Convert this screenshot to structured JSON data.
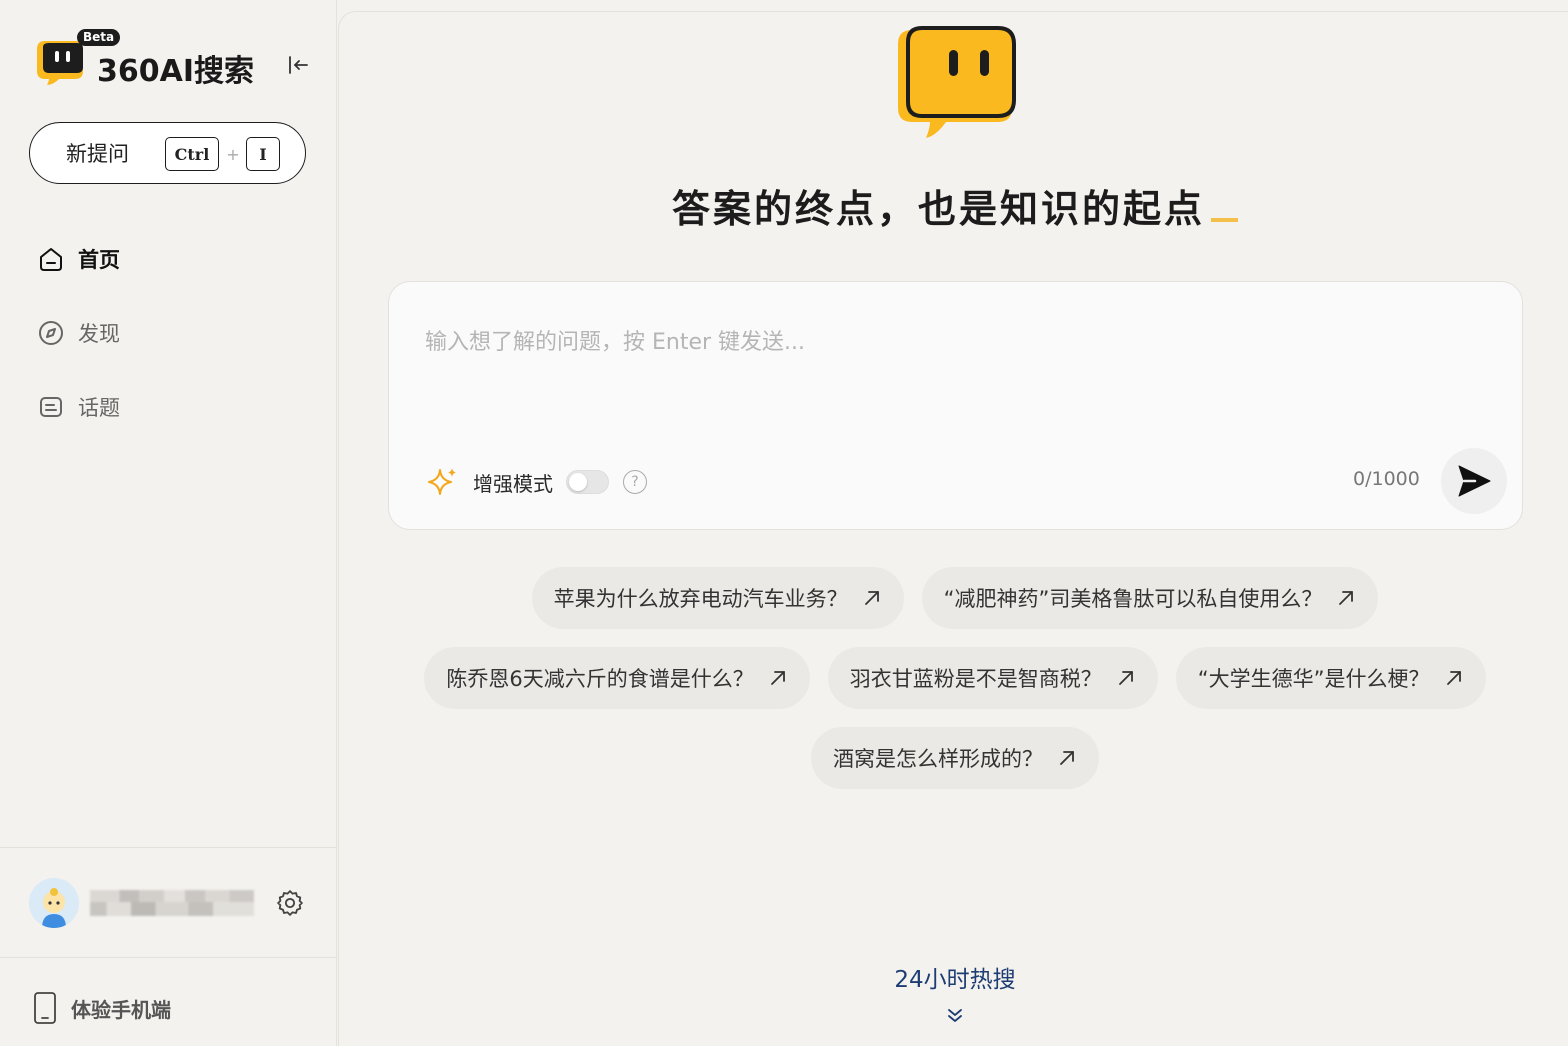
{
  "sidebar": {
    "logo_text": "360AI搜索",
    "beta": "Beta",
    "new_question": {
      "label": "新提问",
      "shortcut_ctrl": "Ctrl",
      "shortcut_plus": "+",
      "shortcut_key": "I"
    },
    "nav": [
      {
        "label": "首页",
        "icon": "home-icon",
        "active": true
      },
      {
        "label": "发现",
        "icon": "compass-icon",
        "active": false
      },
      {
        "label": "话题",
        "icon": "topic-icon",
        "active": false
      }
    ],
    "mobile_label": "体验手机端"
  },
  "main": {
    "headline": "答案的终点，也是知识的起点",
    "search": {
      "placeholder": "输入想了解的问题，按 Enter 键发送...",
      "value": "",
      "enhance_label": "增强模式",
      "enhance_on": false,
      "char_count": "0/1000"
    },
    "suggestions": [
      "苹果为什么放弃电动汽车业务？",
      "“减肥神药”司美格鲁肽可以私自使用么？",
      "陈乔恩6天减六斤的食谱是什么？",
      "羽衣甘蓝粉是不是智商税？",
      "“大学生德华”是什么梗？",
      "酒窝是怎么样形成的？"
    ],
    "hot_search": "24小时热搜"
  },
  "colors": {
    "brand_yellow": "#f9b91f",
    "accent_cursor": "#f5c04a",
    "hot_link": "#1e3d73",
    "background": "#f4f2ee"
  }
}
